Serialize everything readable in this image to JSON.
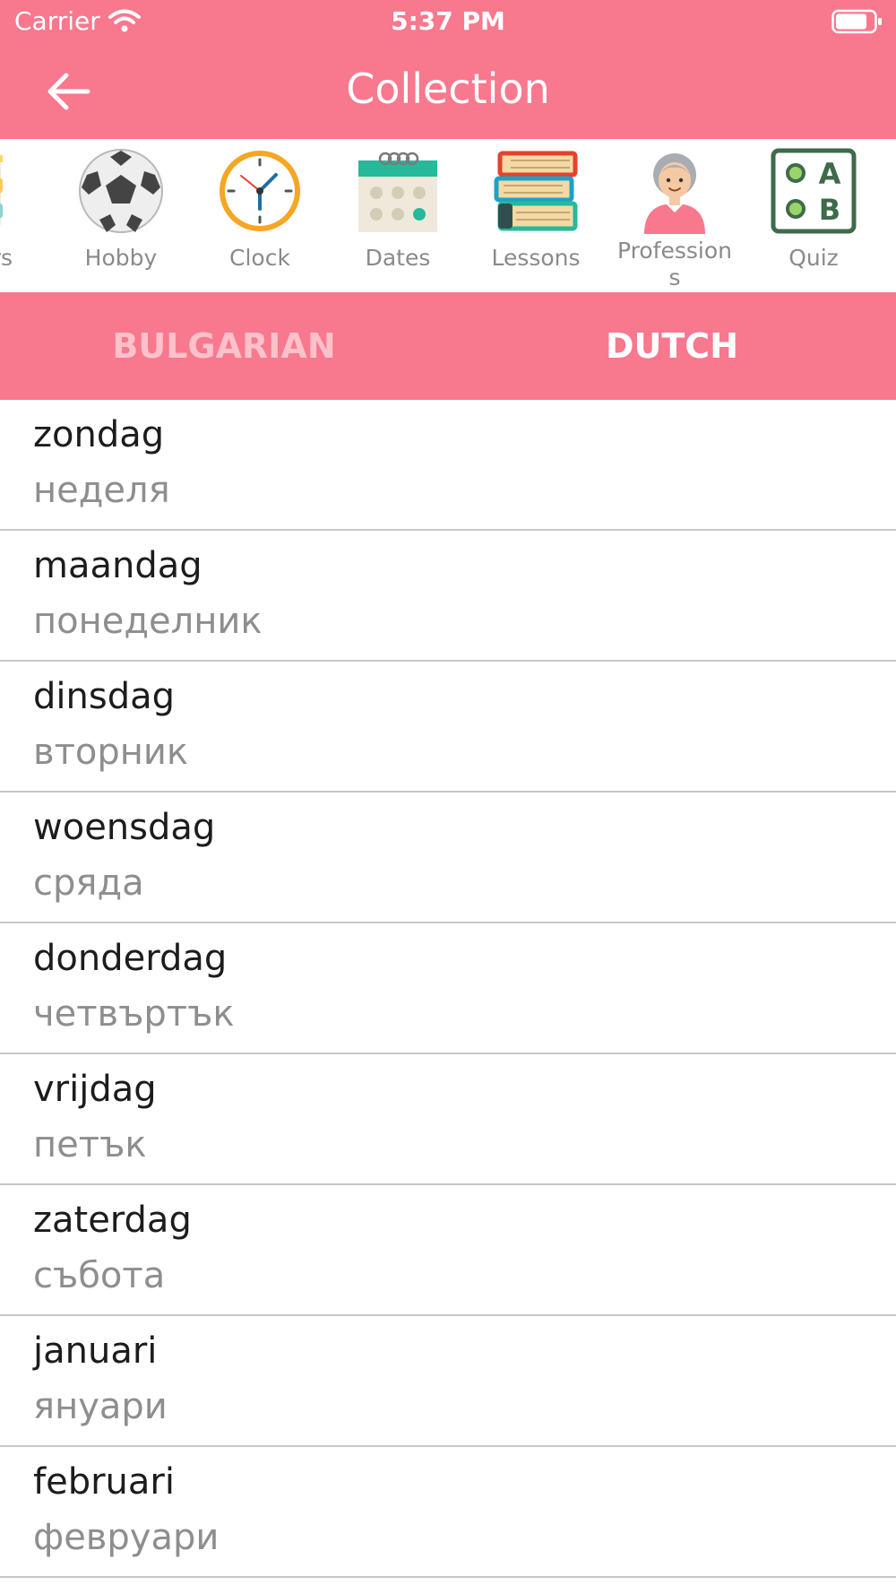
{
  "status_bar": {
    "carrier": "Carrier",
    "time": "5:37 PM",
    "icons": [
      "wifi-icon",
      "battery-icon"
    ]
  },
  "nav": {
    "title": "Collection",
    "back_icon": "arrow-left-icon"
  },
  "categories": {
    "items": [
      {
        "label": "rs",
        "icon": "partial-category-icon"
      },
      {
        "label": "Hobby",
        "icon": "soccer-ball-icon"
      },
      {
        "label": "Clock",
        "icon": "clock-icon"
      },
      {
        "label": "Dates",
        "icon": "calendar-icon"
      },
      {
        "label": "Lessons",
        "icon": "books-icon"
      },
      {
        "label": "Profession\ns",
        "icon": "person-icon"
      },
      {
        "label": "Quiz",
        "icon": "quiz-icon"
      }
    ]
  },
  "language_tabs": {
    "bulgarian": "BULGARIAN",
    "dutch": "DUTCH",
    "selected": "DUTCH"
  },
  "words": [
    {
      "dutch": "zondag",
      "bulgarian": "неделя"
    },
    {
      "dutch": "maandag",
      "bulgarian": "понеделник"
    },
    {
      "dutch": "dinsdag",
      "bulgarian": "вторник"
    },
    {
      "dutch": "woensdag",
      "bulgarian": "сряда"
    },
    {
      "dutch": "donderdag",
      "bulgarian": "четвъртък"
    },
    {
      "dutch": "vrijdag",
      "bulgarian": "петък"
    },
    {
      "dutch": "zaterdag",
      "bulgarian": "събота"
    },
    {
      "dutch": "januari",
      "bulgarian": "януари"
    },
    {
      "dutch": "februari",
      "bulgarian": "февруари"
    }
  ],
  "colors": {
    "accent": "#f8788e",
    "tab_inactive": "#fcc1cb",
    "divider": "#c8c8c8"
  }
}
